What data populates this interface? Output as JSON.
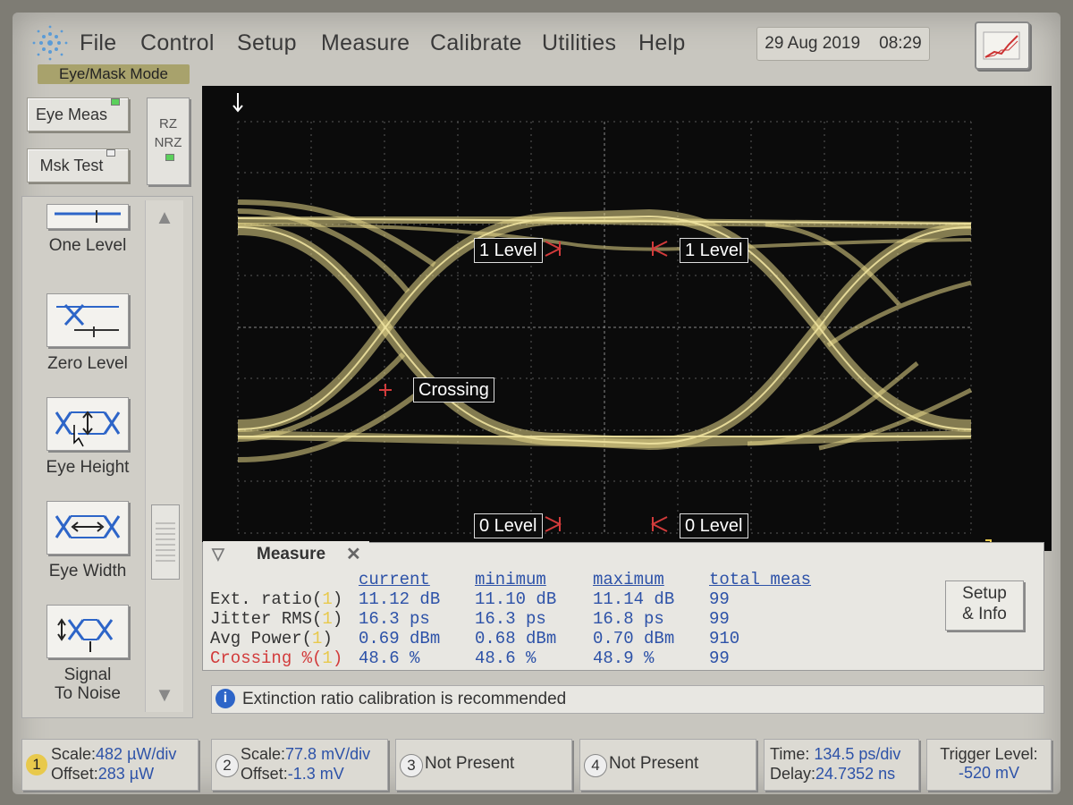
{
  "menu": {
    "items": [
      "File",
      "Control",
      "Setup",
      "Measure",
      "Calibrate",
      "Utilities",
      "Help"
    ],
    "underline": [
      "F",
      "C",
      "S",
      "M",
      "l",
      "U",
      "H"
    ]
  },
  "datetime": {
    "date": "29 Aug 2019",
    "time": "08:29"
  },
  "mode_label": "Eye/Mask Mode",
  "left_panel": {
    "eye_meas": "Eye Meas",
    "msk_test": "Msk Test",
    "rz": "RZ",
    "nrz": "NRZ",
    "tools": [
      {
        "label": "One Level",
        "icon": "one-level-icon"
      },
      {
        "label": "Zero Level",
        "icon": "zero-level-icon"
      },
      {
        "label": "Eye Height",
        "icon": "eye-height-icon"
      },
      {
        "label": "Eye Width",
        "icon": "eye-width-icon"
      },
      {
        "label": "Signal\nTo Noise",
        "icon": "signal-to-noise-icon"
      }
    ]
  },
  "display": {
    "markers": {
      "level1_left": "1 Level",
      "level1_right": "1 Level",
      "crossing": "Crossing",
      "level0_left": "0 Level",
      "level0_right": "0 Level"
    },
    "trace_color": "#e8d98a"
  },
  "measure": {
    "title": "Measure",
    "columns": [
      "current",
      "minimum",
      "maximum",
      "total meas"
    ],
    "rows": [
      {
        "name": "Ext. ratio(",
        "chan": "1",
        "current": "11.12 dB",
        "minimum": "11.10 dB",
        "maximum": "11.14 dB",
        "total": "99"
      },
      {
        "name": "Jitter RMS(",
        "chan": "1",
        "current": "16.3 ps",
        "minimum": "16.3 ps",
        "maximum": "16.8 ps",
        "total": "99"
      },
      {
        "name": "Avg Power(",
        "chan": "1",
        "current": "0.69 dBm",
        "minimum": "0.68 dBm",
        "maximum": "0.70 dBm",
        "total": "910"
      },
      {
        "name": "Crossing %(",
        "chan": "1",
        "current": "48.6 %",
        "minimum": "48.6 %",
        "maximum": "48.9 %",
        "total": "99"
      }
    ],
    "setup_info": "Setup\n& Info"
  },
  "status_message": "Extinction ratio calibration is recommended",
  "channels": [
    {
      "num": "1",
      "scale_label": "Scale:",
      "scale": "482 µW/div",
      "offset_label": "Offset:",
      "offset": "283 µW"
    },
    {
      "num": "2",
      "scale_label": "Scale:",
      "scale": "77.8 mV/div",
      "offset_label": "Offset:",
      "offset": "-1.3 mV"
    },
    {
      "num": "3",
      "text": "Not Present"
    },
    {
      "num": "4",
      "text": "Not Present"
    }
  ],
  "timebase": {
    "time_label": "Time:",
    "time": "134.5 ps/div",
    "delay_label": "Delay:",
    "delay": "24.7352 ns"
  },
  "trigger": {
    "label": "Trigger Level:",
    "value": "-520 mV"
  },
  "colors": {
    "value_blue": "#2d52a8",
    "highlight_red": "#d23b3b",
    "channel1_yellow": "#e8c94c"
  }
}
